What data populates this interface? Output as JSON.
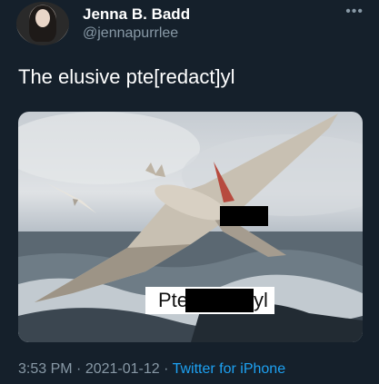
{
  "author": {
    "display_name": "Jenna B. Badd",
    "handle": "@jennapurrlee"
  },
  "more_icon": "more-horizontal-icon",
  "more_glyph": "•••",
  "tweet": {
    "text": "The elusive pte[redact]yl",
    "time": "3:53 PM",
    "separator": " · ",
    "date": "2021-01-12",
    "source": "Twitter for iPhone"
  },
  "image": {
    "caption_pre": "Pte",
    "caption_post": "yl"
  },
  "colors": {
    "background": "#15202b",
    "secondary_text": "#8899a6",
    "link": "#1da1f2"
  }
}
